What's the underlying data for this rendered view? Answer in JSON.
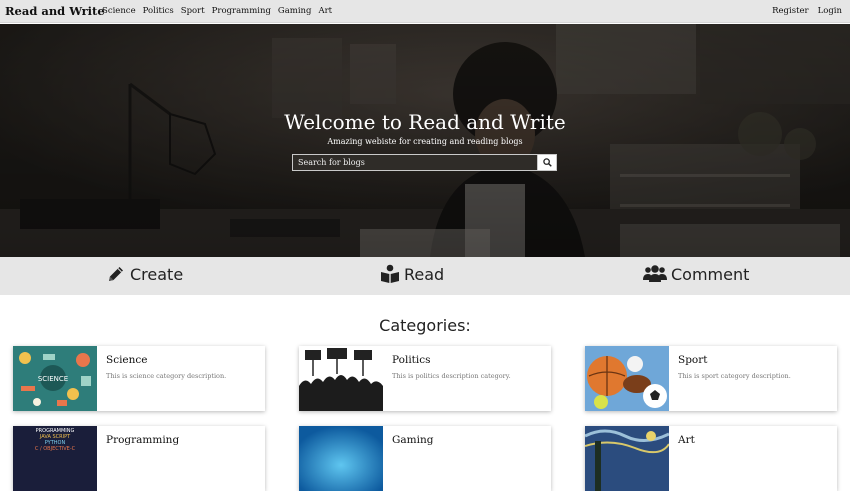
{
  "navbar": {
    "brand": "Read and Write",
    "links": [
      "Science",
      "Politics",
      "Sport",
      "Programming",
      "Gaming",
      "Art"
    ],
    "register": "Register",
    "login": "Login"
  },
  "hero": {
    "title": "Welcome to Read and Write",
    "subtitle": "Amazing webiste for creating and reading blogs",
    "search_placeholder": "Search for blogs"
  },
  "features": [
    {
      "label": "Create",
      "icon": "pencil-icon"
    },
    {
      "label": "Read",
      "icon": "book-reader-icon"
    },
    {
      "label": "Comment",
      "icon": "users-icon"
    }
  ],
  "categories": {
    "heading": "Categories:",
    "items": [
      {
        "title": "Science",
        "description": "This is science category description.",
        "thumb": "science-thumbnail"
      },
      {
        "title": "Politics",
        "description": "This is politics description category.",
        "thumb": "politics-thumbnail"
      },
      {
        "title": "Sport",
        "description": "This is sport category description.",
        "thumb": "sport-thumbnail"
      },
      {
        "title": "Programming",
        "description": "",
        "thumb": "programming-thumbnail",
        "thumb_text": [
          "PROGRAMMING",
          "JAVA SCRIPT",
          "PYTHON",
          "C / OBJECTIVE-C"
        ]
      },
      {
        "title": "Gaming",
        "description": "",
        "thumb": "gaming-thumbnail"
      },
      {
        "title": "Art",
        "description": "",
        "thumb": "art-thumbnail"
      }
    ]
  }
}
